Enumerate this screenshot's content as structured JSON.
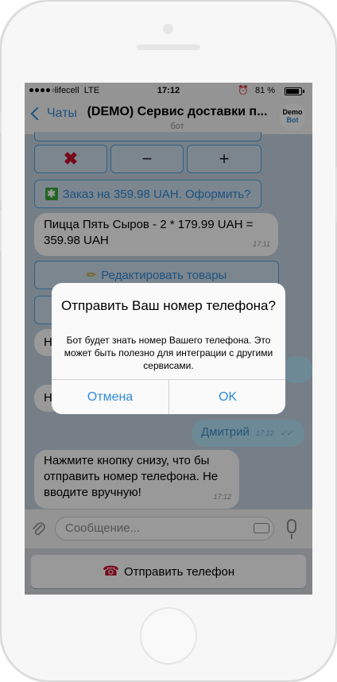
{
  "status_bar": {
    "carrier": "lifecell",
    "network": "LTE",
    "time": "17:12",
    "battery": "81 %"
  },
  "nav": {
    "back_label": "Чаты",
    "title": "(DEMO) Сервис доставки п...",
    "subtitle": "бот",
    "avatar_line1": "Demo",
    "avatar_line2": "Bot"
  },
  "keyboard_inline": {
    "remove": "✖",
    "minus": "−",
    "plus": "+",
    "order": "Заказ на 359.98 UAH. Оформить?",
    "edit": "Редактировать товары"
  },
  "messages": {
    "cart_text": "Пицца Пять Сыров - 2 * 179.99 UAH = 359.98 UAH",
    "cart_time": "17:11",
    "hidden_left_1": "Н",
    "hidden_left_2": "Н",
    "user_name": "Дмитрий",
    "user_time": "17:12",
    "prompt_text": "Нажмите кнопку снизу, что бы отправить номер телефона. Не вводите вручную!",
    "prompt_time": "17:12"
  },
  "input": {
    "placeholder": "Сообщение..."
  },
  "reply_keyboard": {
    "send_phone": "Отправить телефон"
  },
  "alert": {
    "title": "Отправить Ваш номер телефона?",
    "message": "Бот будет знать номер Вашего телефона. Это может быть полезно для интеграции с другими сервисами.",
    "cancel": "Отмена",
    "ok": "OK"
  },
  "colors": {
    "accent": "#2f8bd6",
    "danger": "#c8102e",
    "outgoing_bubble": "#b8e4fb"
  }
}
